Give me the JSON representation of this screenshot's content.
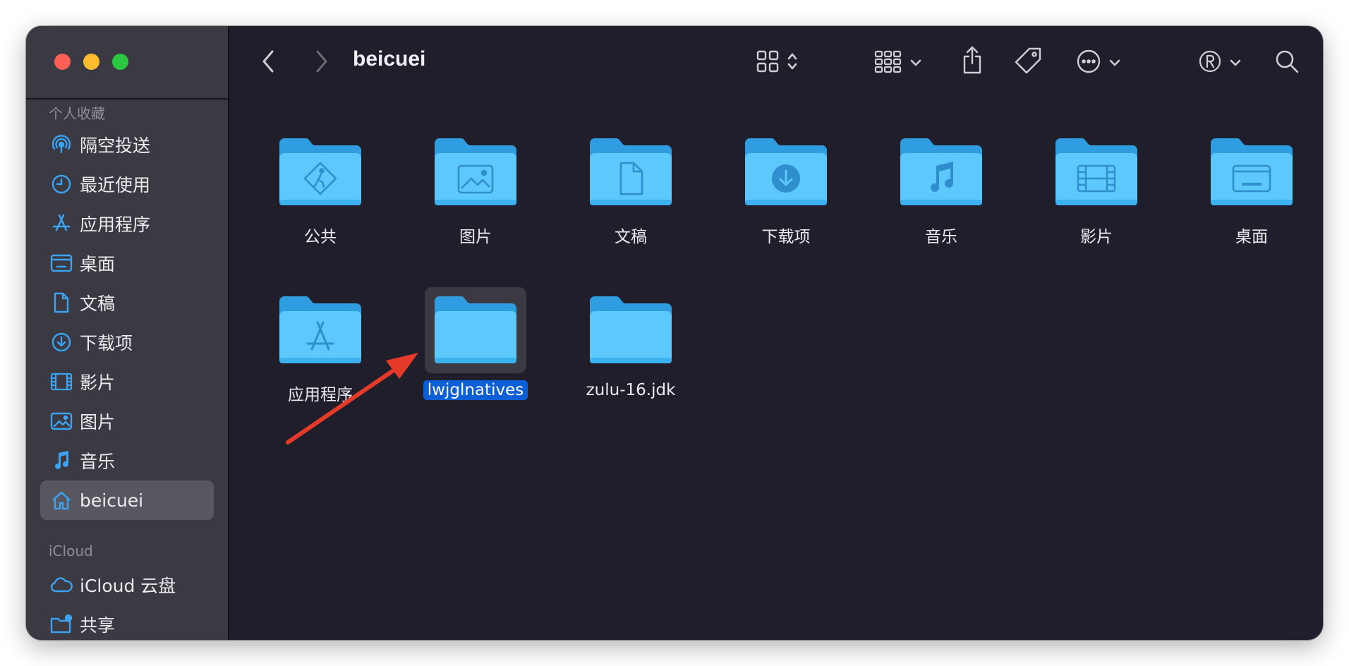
{
  "window": {
    "title": "beicuei"
  },
  "colors": {
    "folder": "#5cc8fb",
    "folder_dark": "#2f9de0",
    "accent": "#0d5fd6",
    "annotation_arrow": "#e53a2a",
    "sidebar_icon": "#3aa3f3"
  },
  "sidebar": {
    "favorites_title": "个人收藏",
    "favorites": [
      {
        "label": "隔空投送",
        "icon": "airdrop-icon"
      },
      {
        "label": "最近使用",
        "icon": "clock-icon"
      },
      {
        "label": "应用程序",
        "icon": "applications-icon"
      },
      {
        "label": "桌面",
        "icon": "desktop-icon"
      },
      {
        "label": "文稿",
        "icon": "document-icon"
      },
      {
        "label": "下载项",
        "icon": "download-icon"
      },
      {
        "label": "影片",
        "icon": "film-icon"
      },
      {
        "label": "图片",
        "icon": "photo-icon"
      },
      {
        "label": "音乐",
        "icon": "music-icon"
      },
      {
        "label": "beicuei",
        "icon": "home-icon",
        "selected": true
      }
    ],
    "icloud_title": "iCloud",
    "icloud": [
      {
        "label": "iCloud 云盘",
        "icon": "cloud-icon"
      },
      {
        "label": "共享",
        "icon": "shared-folder-icon"
      }
    ]
  },
  "toolbar": {
    "buttons": [
      "back-icon",
      "forward-icon",
      "icon-view-icon",
      "group-icon",
      "share-icon",
      "tag-icon",
      "more-icon",
      "registered-icon",
      "search-icon"
    ]
  },
  "content": {
    "items": [
      {
        "label": "公共",
        "glyph": "public-icon"
      },
      {
        "label": "图片",
        "glyph": "photo-icon"
      },
      {
        "label": "文稿",
        "glyph": "document-icon"
      },
      {
        "label": "下载项",
        "glyph": "download-icon"
      },
      {
        "label": "音乐",
        "glyph": "music-icon"
      },
      {
        "label": "影片",
        "glyph": "film-icon"
      },
      {
        "label": "桌面",
        "glyph": "desktop-icon"
      },
      {
        "label": "应用程序",
        "glyph": "applications-icon"
      },
      {
        "label": "lwjglnatives",
        "glyph": "none",
        "selected": true
      },
      {
        "label": "zulu-16.jdk",
        "glyph": "none"
      }
    ]
  }
}
